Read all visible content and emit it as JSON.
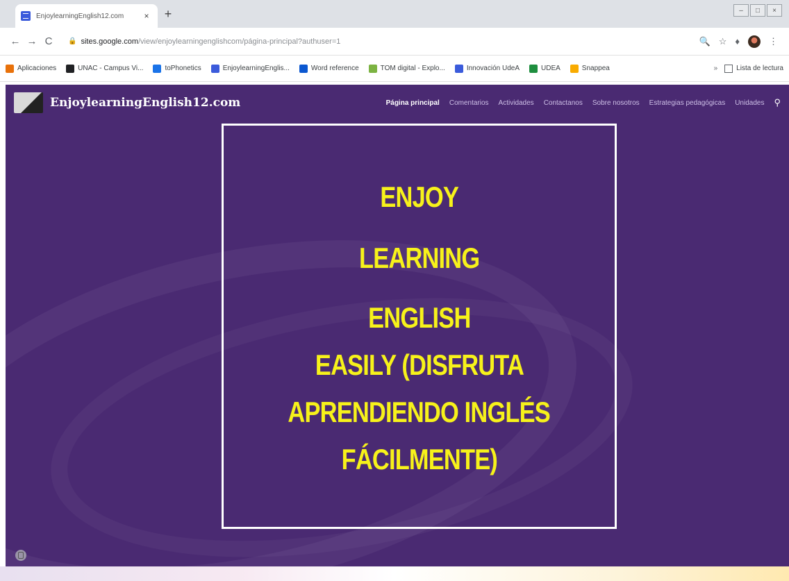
{
  "browser": {
    "tab_title": "EnjoylearningEnglish12.com",
    "tab_close": "×",
    "new_tab": "+",
    "url_host": "sites.google.com",
    "url_path": "/view/enjoylearningenglishcom/página-principal?authuser=1",
    "nav": {
      "back": "←",
      "forward": "→",
      "reload": "C"
    },
    "window_controls": [
      "–",
      "□",
      "×"
    ]
  },
  "bookmarks": [
    {
      "label": "Aplicaciones",
      "icon": "apps-grid-icon",
      "color": "#e8710a"
    },
    {
      "label": "UNAC - Campus Vi...",
      "icon": "globe-icon",
      "color": "#202124"
    },
    {
      "label": "toPhonetics",
      "icon": "tophonetics-icon",
      "color": "#1a73e8"
    },
    {
      "label": "EnjoylearningEnglis...",
      "icon": "google-sites-icon",
      "color": "#3b5bdb"
    },
    {
      "label": "Word reference",
      "icon": "wordreference-icon",
      "color": "#0b57d0"
    },
    {
      "label": "TOM digital - Explo...",
      "icon": "tom-digital-icon",
      "color": "#7cb342"
    },
    {
      "label": "Innovación UdeA",
      "icon": "google-sites-icon",
      "color": "#3b5bdb"
    },
    {
      "label": "UDEA",
      "icon": "google-drive-icon",
      "color": "#1e8e3e"
    },
    {
      "label": "Snappea",
      "icon": "snappea-icon",
      "color": "#f9ab00"
    }
  ],
  "bookmarks_more": "»",
  "reading_list": "Lista de lectura",
  "site": {
    "title": "EnjoylearningEnglish12.com",
    "nav": [
      {
        "label": "Página principal",
        "active": true
      },
      {
        "label": "Comentarios",
        "active": false
      },
      {
        "label": "Actividades",
        "active": false
      },
      {
        "label": "Contactanos",
        "active": false
      },
      {
        "label": "Sobre nosotros",
        "active": false
      },
      {
        "label": "Estrategias pedagógicas",
        "active": false
      },
      {
        "label": "Unidades",
        "active": false
      }
    ],
    "hero_lines": [
      "ENJOY",
      "LEARNING",
      "ENGLISH",
      "EASILY (DISFRUTA",
      "APRENDIENDO INGLÉS",
      "FÁCILMENTE)"
    ],
    "colors": {
      "background": "#4a2a72",
      "hero_text": "#f7f21a",
      "hero_border": "#ffffff"
    }
  }
}
